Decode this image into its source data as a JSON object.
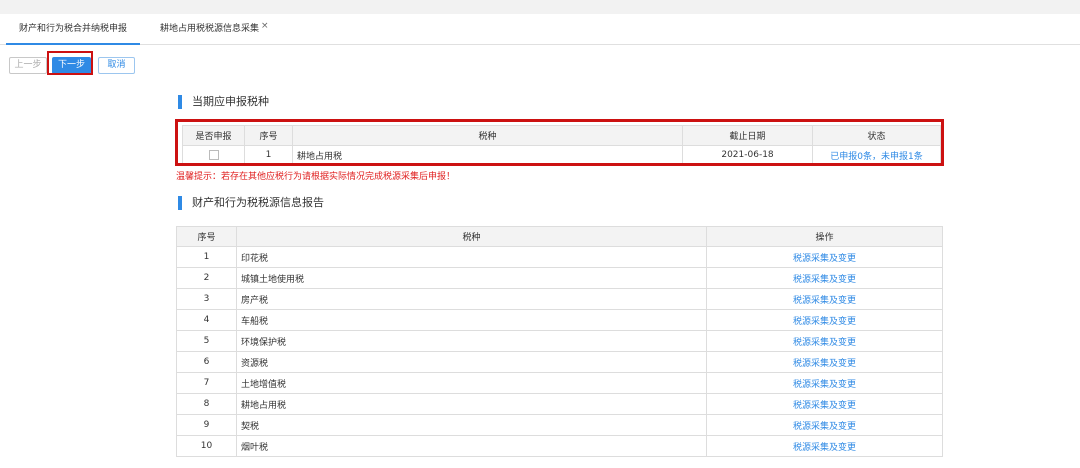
{
  "tabs": [
    {
      "label": "财产和行为税合并纳税申报"
    },
    {
      "label": "耕地占用税税源信息采集",
      "close": "×"
    }
  ],
  "buttons": {
    "prev": "上一步",
    "next": "下一步",
    "cancel": "取消"
  },
  "section1": {
    "title": "当期应申报税种",
    "headers": [
      "是否申报",
      "序号",
      "税种",
      "截止日期",
      "状态"
    ],
    "rows": [
      {
        "index": "1",
        "tax": "耕地占用税",
        "deadline": "2021-06-18",
        "status": "已申报0条，未申报1条"
      }
    ]
  },
  "warning": "温馨提示：若存在其他应税行为请根据实际情况完成税源采集后申报！",
  "section2": {
    "title": "财产和行为税税源信息报告",
    "headers": [
      "序号",
      "税种",
      "操作"
    ],
    "rows": [
      {
        "index": "1",
        "tax": "印花税",
        "action": "税源采集及变更"
      },
      {
        "index": "2",
        "tax": "城镇土地使用税",
        "action": "税源采集及变更"
      },
      {
        "index": "3",
        "tax": "房产税",
        "action": "税源采集及变更"
      },
      {
        "index": "4",
        "tax": "车船税",
        "action": "税源采集及变更"
      },
      {
        "index": "5",
        "tax": "环境保护税",
        "action": "税源采集及变更"
      },
      {
        "index": "6",
        "tax": "资源税",
        "action": "税源采集及变更"
      },
      {
        "index": "7",
        "tax": "土地增值税",
        "action": "税源采集及变更"
      },
      {
        "index": "8",
        "tax": "耕地占用税",
        "action": "税源采集及变更"
      },
      {
        "index": "9",
        "tax": "契税",
        "action": "税源采集及变更"
      },
      {
        "index": "10",
        "tax": "烟叶税",
        "action": "税源采集及变更"
      }
    ]
  },
  "colors": {
    "accent": "#2f8ae5",
    "highlight": "#cc1111",
    "warning": "#e02020"
  }
}
